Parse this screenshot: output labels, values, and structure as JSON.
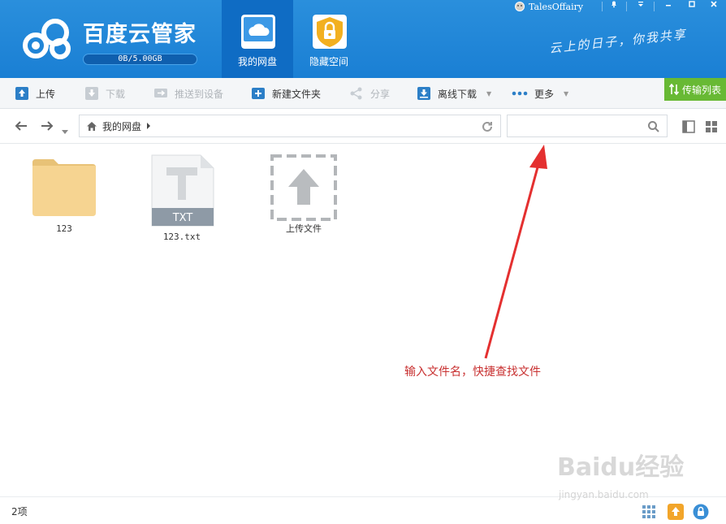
{
  "app": {
    "title": "百度云管家",
    "quota_text": "0B/5.00GB",
    "quota_used_fraction": 0.0,
    "slogan": "云上的日子，你我共享",
    "user": "TalesOffairy"
  },
  "nav_tabs": [
    {
      "label": "我的网盘",
      "icon": "cloud-icon",
      "active": true
    },
    {
      "label": "隐藏空间",
      "icon": "lock-icon",
      "active": false
    }
  ],
  "toolbar": {
    "upload": "上传",
    "download": "下载",
    "push_to_device": "推送到设备",
    "new_folder": "新建文件夹",
    "share": "分享",
    "offline_download": "离线下载",
    "more": "更多",
    "transfer_list": "传输列表"
  },
  "addressbar": {
    "path": "我的网盘",
    "search_placeholder": ""
  },
  "files": [
    {
      "name": "123",
      "type": "folder"
    },
    {
      "name": "123.txt",
      "type": "txt",
      "badge": "TXT"
    },
    {
      "name": "上传文件",
      "type": "upload"
    }
  ],
  "annotation": "输入文件名，快捷查找文件",
  "status": {
    "item_count": "2项"
  },
  "watermark": {
    "main": "Baidu经验",
    "sub": "jingyan.baidu.com"
  },
  "colors": {
    "header": "#1a7fd4",
    "active_tab": "#0f6cc4",
    "transfer_green": "#68b934",
    "annotation_red": "#c83030",
    "arrow_red": "#e43030"
  }
}
